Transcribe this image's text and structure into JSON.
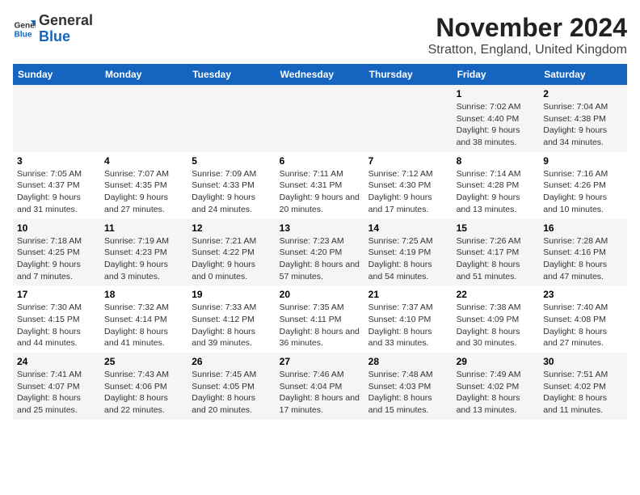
{
  "logo": {
    "general": "General",
    "blue": "Blue"
  },
  "title": "November 2024",
  "location": "Stratton, England, United Kingdom",
  "days_of_week": [
    "Sunday",
    "Monday",
    "Tuesday",
    "Wednesday",
    "Thursday",
    "Friday",
    "Saturday"
  ],
  "weeks": [
    [
      {
        "day": "",
        "info": ""
      },
      {
        "day": "",
        "info": ""
      },
      {
        "day": "",
        "info": ""
      },
      {
        "day": "",
        "info": ""
      },
      {
        "day": "",
        "info": ""
      },
      {
        "day": "1",
        "info": "Sunrise: 7:02 AM\nSunset: 4:40 PM\nDaylight: 9 hours and 38 minutes."
      },
      {
        "day": "2",
        "info": "Sunrise: 7:04 AM\nSunset: 4:38 PM\nDaylight: 9 hours and 34 minutes."
      }
    ],
    [
      {
        "day": "3",
        "info": "Sunrise: 7:05 AM\nSunset: 4:37 PM\nDaylight: 9 hours and 31 minutes."
      },
      {
        "day": "4",
        "info": "Sunrise: 7:07 AM\nSunset: 4:35 PM\nDaylight: 9 hours and 27 minutes."
      },
      {
        "day": "5",
        "info": "Sunrise: 7:09 AM\nSunset: 4:33 PM\nDaylight: 9 hours and 24 minutes."
      },
      {
        "day": "6",
        "info": "Sunrise: 7:11 AM\nSunset: 4:31 PM\nDaylight: 9 hours and 20 minutes."
      },
      {
        "day": "7",
        "info": "Sunrise: 7:12 AM\nSunset: 4:30 PM\nDaylight: 9 hours and 17 minutes."
      },
      {
        "day": "8",
        "info": "Sunrise: 7:14 AM\nSunset: 4:28 PM\nDaylight: 9 hours and 13 minutes."
      },
      {
        "day": "9",
        "info": "Sunrise: 7:16 AM\nSunset: 4:26 PM\nDaylight: 9 hours and 10 minutes."
      }
    ],
    [
      {
        "day": "10",
        "info": "Sunrise: 7:18 AM\nSunset: 4:25 PM\nDaylight: 9 hours and 7 minutes."
      },
      {
        "day": "11",
        "info": "Sunrise: 7:19 AM\nSunset: 4:23 PM\nDaylight: 9 hours and 3 minutes."
      },
      {
        "day": "12",
        "info": "Sunrise: 7:21 AM\nSunset: 4:22 PM\nDaylight: 9 hours and 0 minutes."
      },
      {
        "day": "13",
        "info": "Sunrise: 7:23 AM\nSunset: 4:20 PM\nDaylight: 8 hours and 57 minutes."
      },
      {
        "day": "14",
        "info": "Sunrise: 7:25 AM\nSunset: 4:19 PM\nDaylight: 8 hours and 54 minutes."
      },
      {
        "day": "15",
        "info": "Sunrise: 7:26 AM\nSunset: 4:17 PM\nDaylight: 8 hours and 51 minutes."
      },
      {
        "day": "16",
        "info": "Sunrise: 7:28 AM\nSunset: 4:16 PM\nDaylight: 8 hours and 47 minutes."
      }
    ],
    [
      {
        "day": "17",
        "info": "Sunrise: 7:30 AM\nSunset: 4:15 PM\nDaylight: 8 hours and 44 minutes."
      },
      {
        "day": "18",
        "info": "Sunrise: 7:32 AM\nSunset: 4:14 PM\nDaylight: 8 hours and 41 minutes."
      },
      {
        "day": "19",
        "info": "Sunrise: 7:33 AM\nSunset: 4:12 PM\nDaylight: 8 hours and 39 minutes."
      },
      {
        "day": "20",
        "info": "Sunrise: 7:35 AM\nSunset: 4:11 PM\nDaylight: 8 hours and 36 minutes."
      },
      {
        "day": "21",
        "info": "Sunrise: 7:37 AM\nSunset: 4:10 PM\nDaylight: 8 hours and 33 minutes."
      },
      {
        "day": "22",
        "info": "Sunrise: 7:38 AM\nSunset: 4:09 PM\nDaylight: 8 hours and 30 minutes."
      },
      {
        "day": "23",
        "info": "Sunrise: 7:40 AM\nSunset: 4:08 PM\nDaylight: 8 hours and 27 minutes."
      }
    ],
    [
      {
        "day": "24",
        "info": "Sunrise: 7:41 AM\nSunset: 4:07 PM\nDaylight: 8 hours and 25 minutes."
      },
      {
        "day": "25",
        "info": "Sunrise: 7:43 AM\nSunset: 4:06 PM\nDaylight: 8 hours and 22 minutes."
      },
      {
        "day": "26",
        "info": "Sunrise: 7:45 AM\nSunset: 4:05 PM\nDaylight: 8 hours and 20 minutes."
      },
      {
        "day": "27",
        "info": "Sunrise: 7:46 AM\nSunset: 4:04 PM\nDaylight: 8 hours and 17 minutes."
      },
      {
        "day": "28",
        "info": "Sunrise: 7:48 AM\nSunset: 4:03 PM\nDaylight: 8 hours and 15 minutes."
      },
      {
        "day": "29",
        "info": "Sunrise: 7:49 AM\nSunset: 4:02 PM\nDaylight: 8 hours and 13 minutes."
      },
      {
        "day": "30",
        "info": "Sunrise: 7:51 AM\nSunset: 4:02 PM\nDaylight: 8 hours and 11 minutes."
      }
    ]
  ]
}
